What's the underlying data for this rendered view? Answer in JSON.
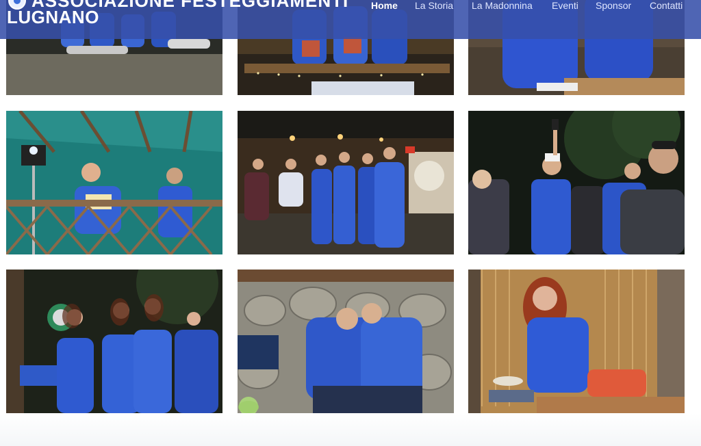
{
  "header": {
    "brand_line1": "ASSOCIAZIONE FESTEGGIAMENTI",
    "brand_line2": "LUGNANO",
    "logo_icon": "association-logo-icon",
    "bg_color": "#3750aa"
  },
  "nav": {
    "items": [
      {
        "label": "Home",
        "active": true
      },
      {
        "label": "La Storia",
        "active": false
      },
      {
        "label": "La Madonnina",
        "active": false
      },
      {
        "label": "Eventi",
        "active": false
      },
      {
        "label": "Sponsor",
        "active": false
      },
      {
        "label": "Contatti",
        "active": false
      }
    ]
  },
  "gallery": {
    "photos": [
      {
        "subject": "group-crouching"
      },
      {
        "subject": "stall-counter"
      },
      {
        "subject": "volunteers-seated"
      },
      {
        "subject": "stage-award"
      },
      {
        "subject": "night-group-stall"
      },
      {
        "subject": "microphone-crowd"
      },
      {
        "subject": "girls-blue-jackets"
      },
      {
        "subject": "couple-stone-wall"
      },
      {
        "subject": "woman-bamboo-stall"
      }
    ],
    "accent_color": "#2f4fd6"
  }
}
